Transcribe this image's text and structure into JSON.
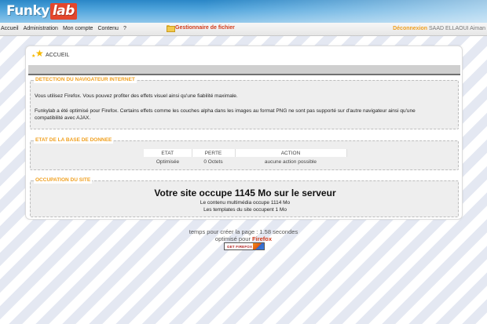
{
  "header": {
    "logo_funky": "Funky",
    "logo_lab": "lab"
  },
  "menu": {
    "items": [
      "Accueil",
      "Administration",
      "Mon compte",
      "Contenu",
      "?"
    ],
    "file_manager": "Gestionnaire de fichier",
    "logout": "Déconnexion",
    "user": "SAAD ELLAOUI Aiman"
  },
  "breadcrumb": "ACCUEIL",
  "browser_section": {
    "title": "DETECTION DU NAVIGATEUR INTERNET",
    "line1": "Vous utilisez Firefox. Vous pouvez profiter des effets visuel ainsi qu'une fiabilité maximale.",
    "line2": "Funkylab a été optimisé pour Firefox. Certains effets comme les couches alpha dans les images au format PNG ne sont pas supporté sur d'autre navigateur ainsi qu'une",
    "line3": "compatibilité avec AJAX."
  },
  "db_section": {
    "title": "ETAT DE LA BASE DE DONNEE",
    "headers": [
      "ETAT",
      "PERTE",
      "ACTION"
    ],
    "row": [
      "Optimisée",
      "0 Octets",
      "aucune action possible"
    ]
  },
  "site_section": {
    "title": "OCCUPATION DU SITE",
    "main": "Votre site occupe 1145 Mo sur le serveur",
    "media": "Le contenu multimédia occupe 1114 Mo",
    "templates": "Les templates du site occupent 1 Mo"
  },
  "footer": {
    "timing": "temps pour créer la page : 1.58 secondes",
    "optimized_prefix": "optimisé pour",
    "optimized_browser": "Firefox",
    "badge": "GET FIREFOX"
  },
  "colors": {
    "accent_orange": "#f0a020",
    "link_red": "#d23b1b",
    "header_blue": "#2b87c7"
  }
}
